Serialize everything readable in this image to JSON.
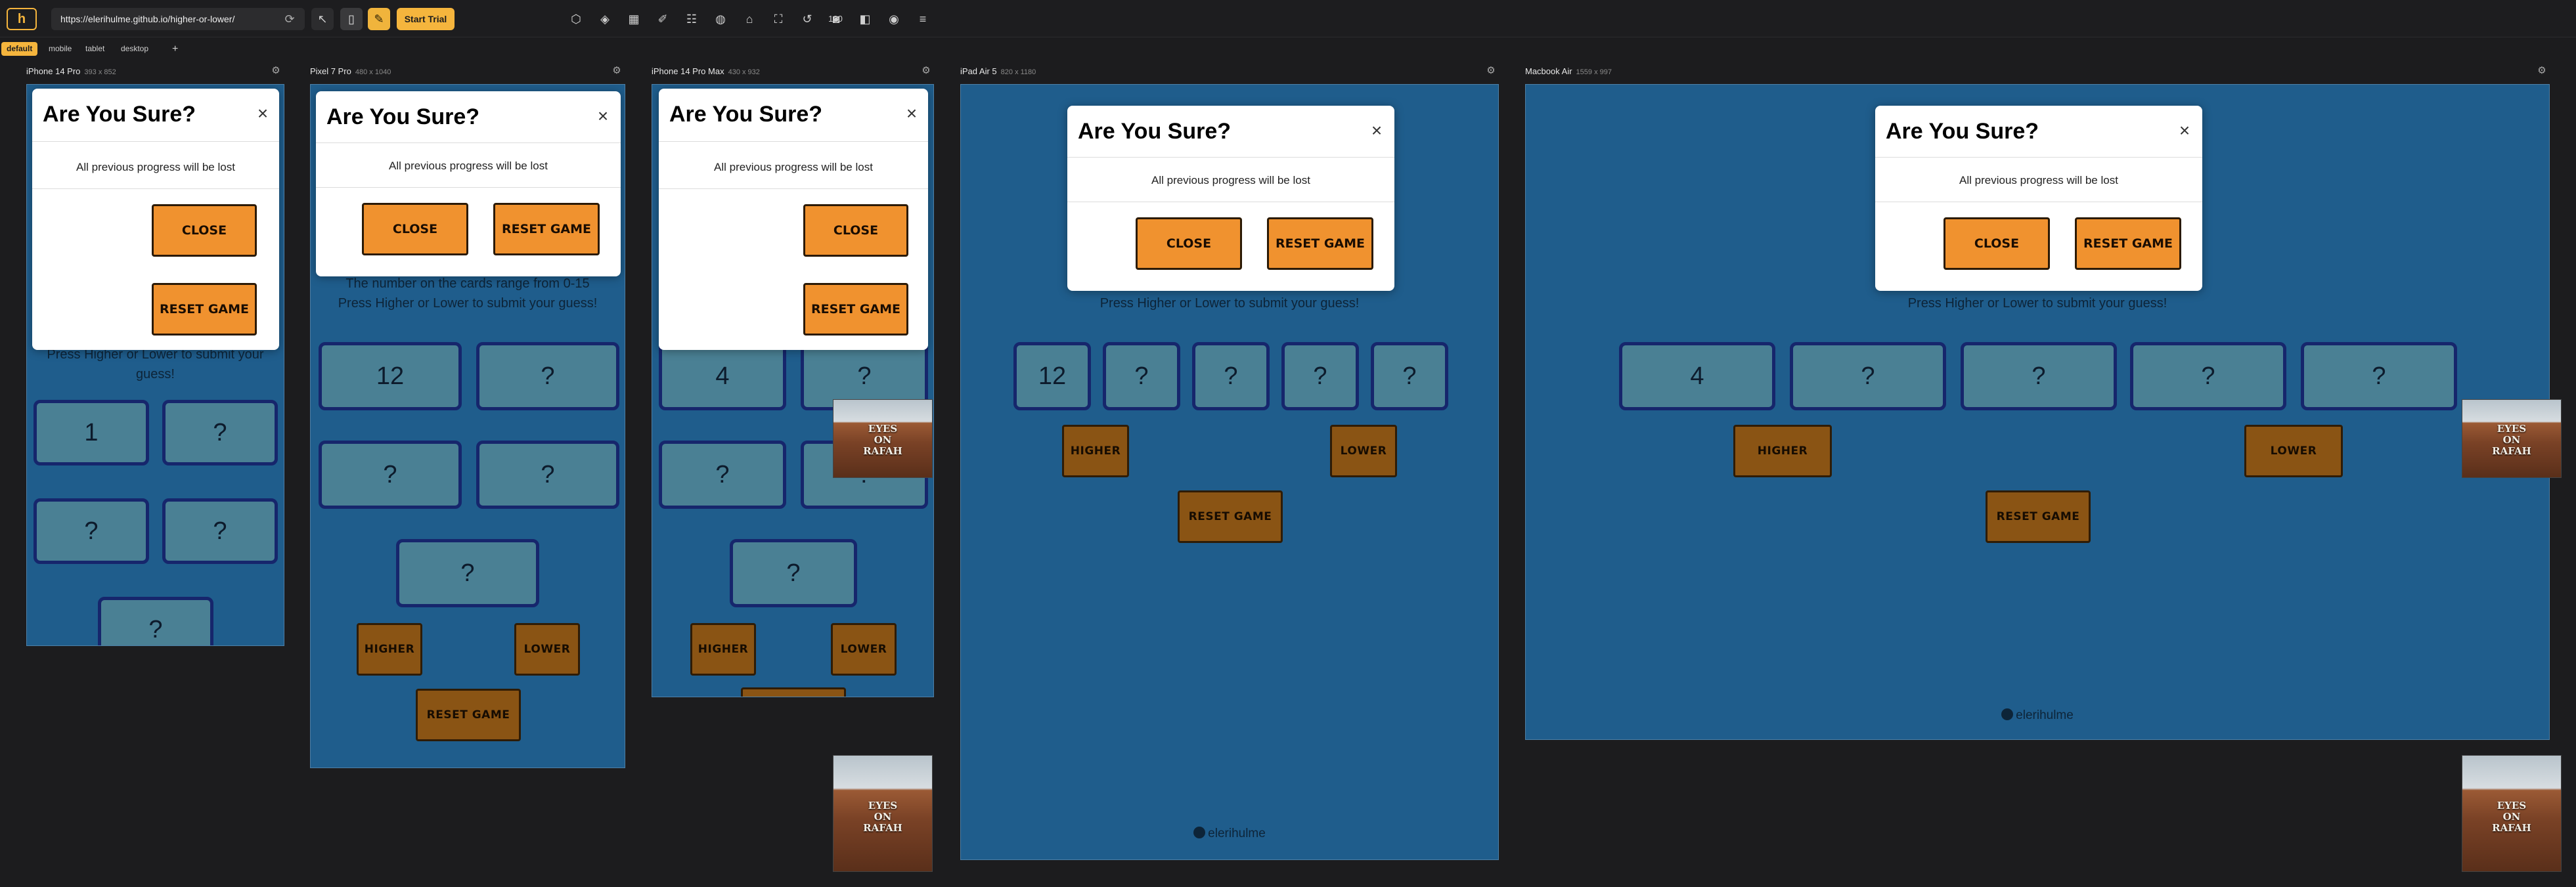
{
  "toolbar": {
    "logo": "h",
    "url": "https://elerihulme.github.io/higher-or-lower/",
    "start_trial": "Start Trial",
    "zoom_level": "100",
    "icons": [
      "cursor-icon",
      "mobile-icon",
      "chat-icon",
      "cube-icon",
      "layers-icon",
      "grid-icon",
      "ruler-icon",
      "list-icon",
      "lock-icon",
      "camera-icon",
      "expand-icon",
      "undo-icon",
      "screenshot-icon",
      "zoom-icon",
      "sidebar-icon",
      "help-icon",
      "menu-icon"
    ]
  },
  "presets": [
    "default",
    "mobile",
    "tablet",
    "desktop"
  ],
  "add_preset": "+",
  "devices": [
    {
      "name": "iPhone 14 Pro",
      "dims": "393 x 852"
    },
    {
      "name": "Pixel 7 Pro",
      "dims": "480 x 1040"
    },
    {
      "name": "iPhone 14 Pro Max",
      "dims": "430 x 932"
    },
    {
      "name": "iPad Air 5",
      "dims": "820 x 1180"
    },
    {
      "name": "Macbook Air",
      "dims": "1559 x 997"
    }
  ],
  "game": {
    "range_text": "The number on the cards range from 0-15",
    "instructions": "Press Higher or Lower to submit your guess!",
    "instructions_partial": "Press Higher or Lower to submit your",
    "instructions_partial2": "guess!",
    "higher": "Higher",
    "lower": "Lower",
    "reset": "Reset Game",
    "unknown_card": "?",
    "footer": "elerihulme"
  },
  "cards": {
    "iphone14pro": [
      "1",
      "?",
      "?",
      "?",
      "?"
    ],
    "pixel7pro": [
      "12",
      "?",
      "?",
      "?",
      "?"
    ],
    "iphone14promax": [
      "4",
      "?",
      "?",
      "?",
      "?"
    ],
    "ipadair5": [
      "12",
      "?",
      "?",
      "?",
      "?"
    ],
    "macbookair": [
      "4",
      "?",
      "?",
      "?",
      "?"
    ]
  },
  "modal": {
    "title": "Are You Sure?",
    "body": "All previous progress will be lost",
    "close": "Close",
    "reset": "Reset Game",
    "close_glyph": "×"
  },
  "image_banner": {
    "text_lines": [
      "EYES",
      "ON",
      "RAFAH"
    ]
  }
}
